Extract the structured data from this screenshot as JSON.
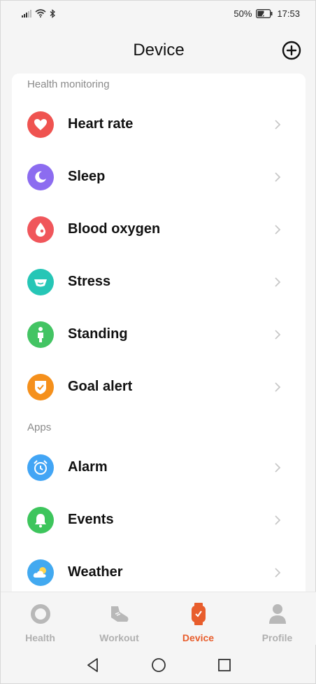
{
  "status_bar": {
    "battery_percent": "50%",
    "time": "17:53"
  },
  "header": {
    "title": "Device",
    "add_icon": "plus-circle-icon"
  },
  "sections": [
    {
      "title": "Health monitoring"
    },
    {
      "title": "Apps"
    }
  ],
  "items": [
    {
      "label": "Heart rate",
      "icon": "heart-icon",
      "color": "#ef5350"
    },
    {
      "label": "Sleep",
      "icon": "moon-icon",
      "color": "#8c6cf0"
    },
    {
      "label": "Blood oxygen",
      "icon": "drop-icon",
      "color": "#f0565b"
    },
    {
      "label": "Stress",
      "icon": "stress-icon",
      "color": "#26c6b6"
    },
    {
      "label": "Standing",
      "icon": "person-standing-icon",
      "color": "#43c463"
    },
    {
      "label": "Goal alert",
      "icon": "shield-check-icon",
      "color": "#f5901c"
    },
    {
      "label": "Alarm",
      "icon": "alarm-clock-icon",
      "color": "#42a5f5"
    },
    {
      "label": "Events",
      "icon": "bell-icon",
      "color": "#3dc55c"
    },
    {
      "label": "Weather",
      "icon": "weather-icon",
      "color": "#42a9f0"
    }
  ],
  "bottom_nav": [
    {
      "label": "Health",
      "icon": "ring-icon",
      "active": false
    },
    {
      "label": "Workout",
      "icon": "shoe-icon",
      "active": false
    },
    {
      "label": "Device",
      "icon": "watch-icon",
      "active": true
    },
    {
      "label": "Profile",
      "icon": "person-icon",
      "active": false
    }
  ],
  "colors": {
    "accent": "#e85d2c",
    "inactive": "#b0b0b0"
  }
}
